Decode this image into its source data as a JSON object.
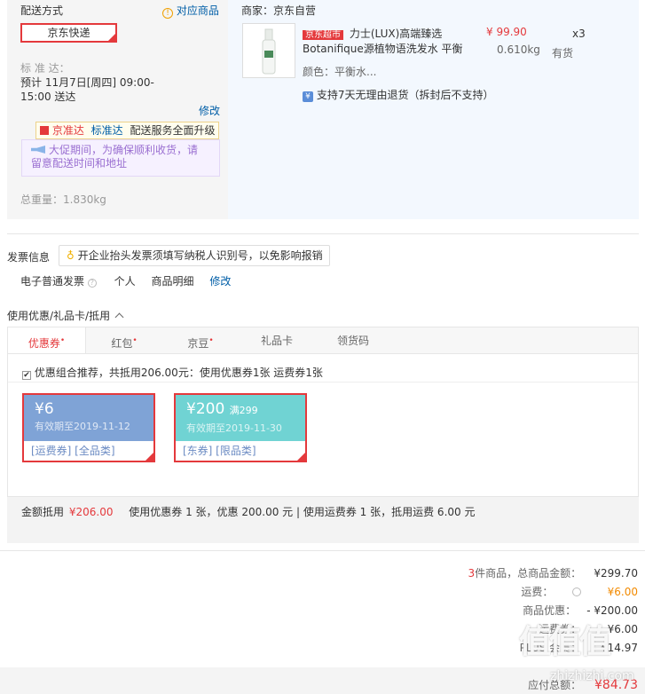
{
  "shipping": {
    "title": "配送方式",
    "match_label": "对应商品",
    "method": "京东快递",
    "std_label": "标 准 达：",
    "eta_line1": "预计 11月7日[周四] 09:00-",
    "eta_line2": "15:00 送达",
    "modify": "修改",
    "jzd_brand": "京准达",
    "jzd_std": "标准达",
    "jzd_upgrade": "配送服务全面升级",
    "promo_line1": "大促期间，为确保顺利收货，请",
    "promo_line2": "留意配送时间和地址",
    "weight": "总重量：1.830kg"
  },
  "product": {
    "seller": "商家：京东自营",
    "tag": "京东超市",
    "name_line1": "力士(LUX)高端臻选",
    "name_line2": "Botanifique源植物语洗发水 平衡",
    "color": "颜色：平衡水...",
    "price": "¥ 99.90",
    "qty": "x3",
    "weight": "0.610kg",
    "stock": "有货",
    "return_policy": "支持7天无理由退货（拆封后不支持）"
  },
  "invoice": {
    "label": "发票信息",
    "tip": "开企业抬头发票须填写纳税人识别号，以免影响报销",
    "type": "电子普通发票",
    "title": "个人",
    "content": "商品明细",
    "modify": "修改"
  },
  "discount": {
    "header": "使用优惠/礼品卡/抵用",
    "tabs": [
      "优惠券",
      "红包",
      "京豆",
      "礼品卡",
      "领货码"
    ],
    "tab_marks": [
      "•",
      "•",
      "•",
      "",
      ""
    ],
    "recommend": "优惠组合推荐，共抵用206.00元：使用优惠券1张 运费券1张",
    "coupons": [
      {
        "amount": "¥6",
        "threshold": "",
        "date": "有效期至2019-11-12",
        "tags": "[运费券]  [全品类]",
        "color": "#7fa3d6"
      },
      {
        "amount": "¥200",
        "threshold": "满299",
        "date": "有效期至2019-11-30",
        "tags": "[东券]  [限品类]",
        "color": "#70d3d3"
      }
    ],
    "summary_label": "金额抵用",
    "summary_amount": "¥206.00",
    "summary_text": "使用优惠券 1 张，优惠 200.00 元 | 使用运费券 1 张，抵用运费 6.00 元"
  },
  "totals": {
    "count": "3",
    "count_text": "件商品，总商品金额：",
    "goods_amount": "¥299.70",
    "freight_label": "运费：",
    "freight": "¥6.00",
    "discount_label": "商品优惠：",
    "discount": "- ¥200.00",
    "row4_label": "运费券：",
    "row4": "- ¥6.00",
    "plus_label": "PLUS 会员：",
    "plus": "- ¥14.97",
    "pay_label": "应付总额：",
    "pay": "¥84.73"
  },
  "watermark": {
    "logo": "值值值",
    "url": "zhizhizhi.com"
  }
}
